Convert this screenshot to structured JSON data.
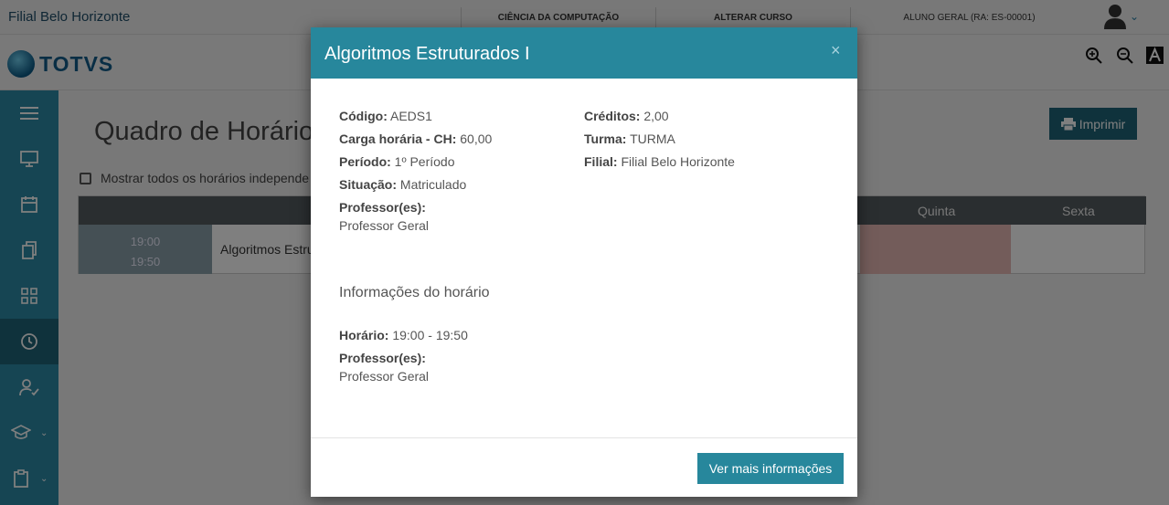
{
  "topbar": {
    "filial": "Filial Belo Horizonte",
    "course": "CIÊNCIA DA COMPUTAÇÃO",
    "change_course": "ALTERAR CURSO",
    "user": "ALUNO GERAL (RA: ES-00001)"
  },
  "logo": {
    "text": "TOTVS"
  },
  "page": {
    "title": "Quadro de Horário",
    "show_all_label": "Mostrar todos os horários independe",
    "print_label": "Imprimir"
  },
  "table": {
    "headers": {
      "quinta": "Quinta",
      "sexta": "Sexta"
    },
    "time_start": "19:00",
    "time_end": "19:50",
    "course": "Algoritmos Estru"
  },
  "modal": {
    "title": "Algoritmos Estruturados I",
    "close": "×",
    "left": [
      {
        "label": "Código:",
        "value": "AEDS1"
      },
      {
        "label": "Carga horária - CH:",
        "value": "60,00"
      },
      {
        "label": "Período:",
        "value": "1º Período"
      },
      {
        "label": "Situação:",
        "value": "Matriculado"
      }
    ],
    "professors_label": "Professor(es):",
    "professors_value": "Professor Geral",
    "right": [
      {
        "label": "Créditos:",
        "value": "2,00"
      },
      {
        "label": "Turma:",
        "value": "TURMA"
      },
      {
        "label": "Filial:",
        "value": "Filial Belo Horizonte"
      }
    ],
    "schedule_section": "Informações do horário",
    "schedule_label": "Horário:",
    "schedule_value": "19:00 - 19:50",
    "schedule_prof_label": "Professor(es):",
    "schedule_prof_value": "Professor Geral",
    "more_button": "Ver mais informações"
  },
  "colors": {
    "accent": "#27879c",
    "sidebar": "#2d8ba7",
    "sidebar_active": "#1f6578"
  }
}
